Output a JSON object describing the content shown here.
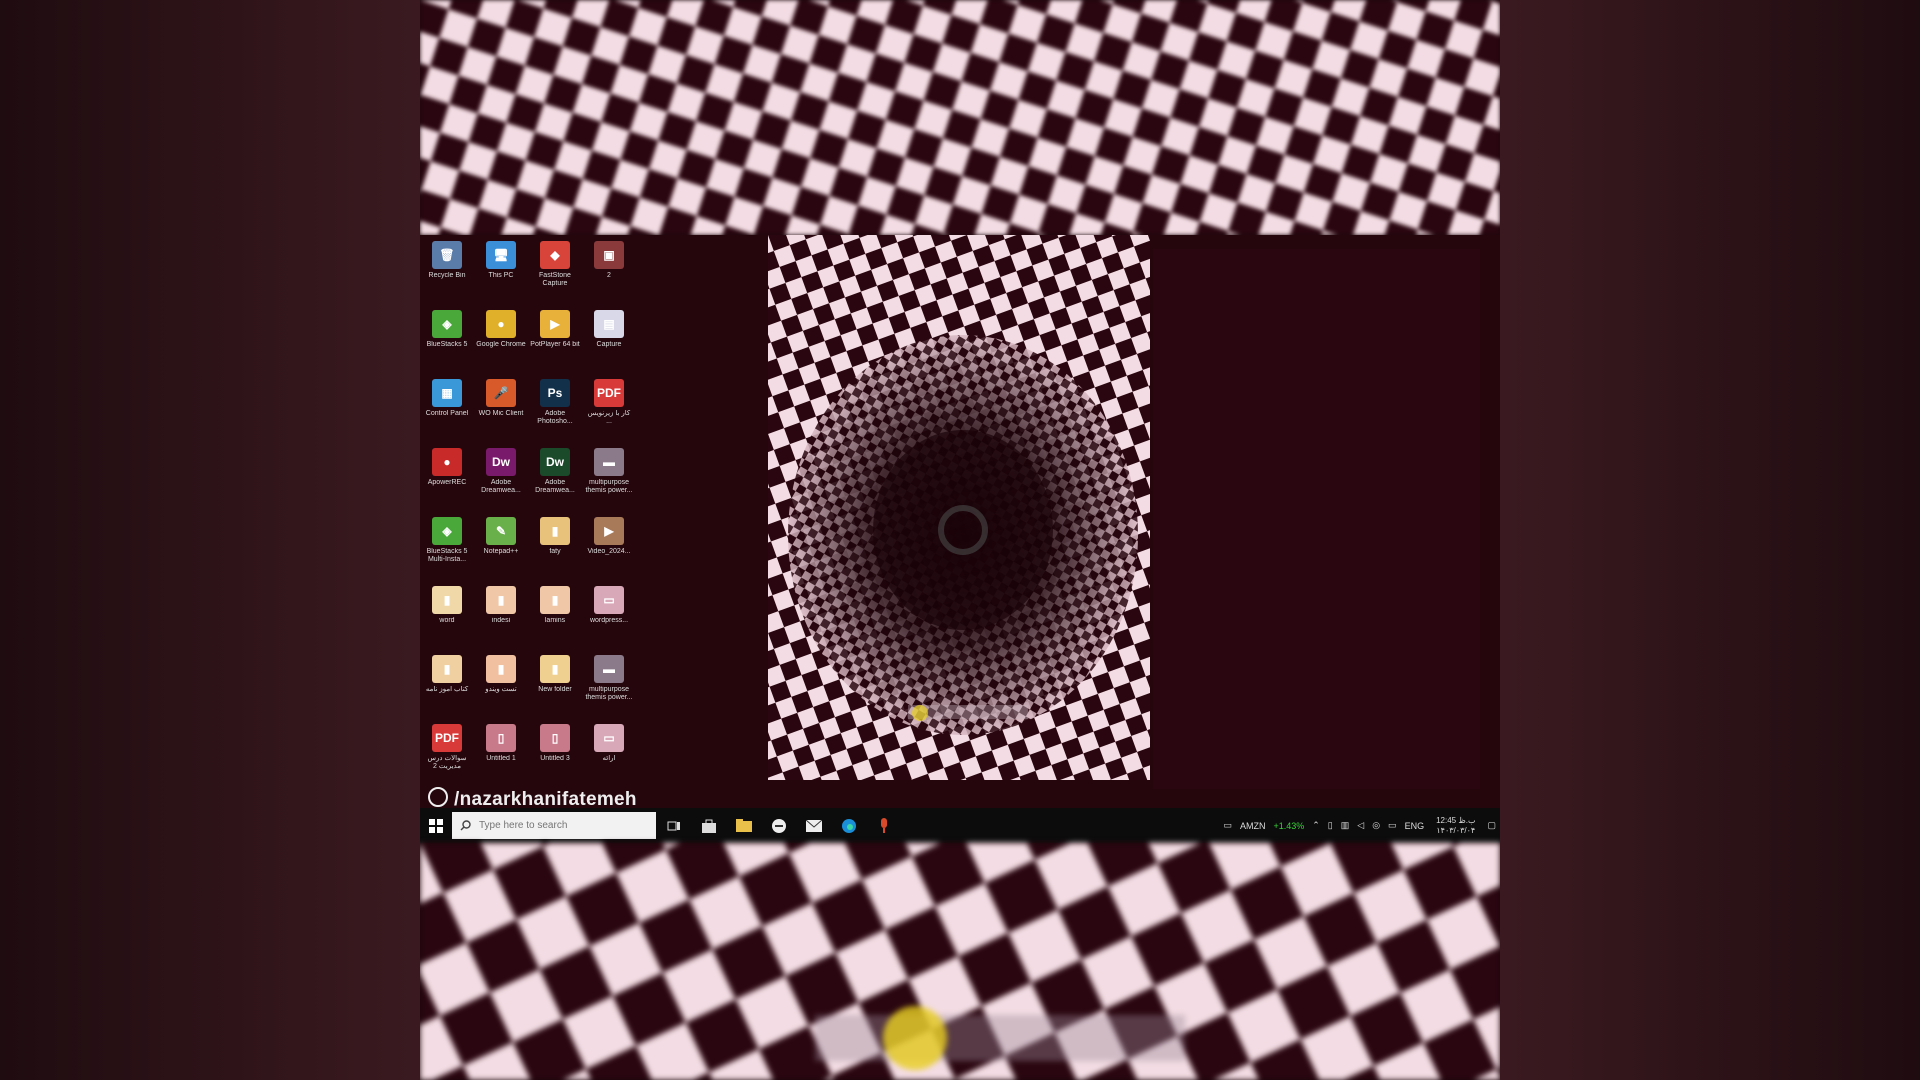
{
  "desktop": {
    "icons": [
      {
        "label": "Recycle Bin",
        "glyph": "🗑",
        "color": "#5a7ca8"
      },
      {
        "label": "This PC",
        "glyph": "🖥",
        "color": "#3a8fd8"
      },
      {
        "label": "FastStone Capture",
        "glyph": "◆",
        "color": "#d8443a"
      },
      {
        "label": "2",
        "glyph": "▣",
        "color": "#8a3a3a"
      },
      {
        "label": "BlueStacks 5",
        "glyph": "◈",
        "color": "#4aa83a"
      },
      {
        "label": "Google Chrome",
        "glyph": "●",
        "color": "#e0b02a"
      },
      {
        "label": "PotPlayer 64 bit",
        "glyph": "▶",
        "color": "#e8b23a"
      },
      {
        "label": "Capture",
        "glyph": "▤",
        "color": "#d8d8e8"
      },
      {
        "label": "Control Panel",
        "glyph": "▦",
        "color": "#3a98d8"
      },
      {
        "label": "WO Mic Client",
        "glyph": "🎤",
        "color": "#d85a2a"
      },
      {
        "label": "Adobe Photosho...",
        "glyph": "Ps",
        "color": "#12304a"
      },
      {
        "label": "کار با زیرنویس ...",
        "glyph": "PDF",
        "color": "#d83a3a"
      },
      {
        "label": "ApowerREC",
        "glyph": "●",
        "color": "#c82a2a"
      },
      {
        "label": "Adobe Dreamwea...",
        "glyph": "Dw",
        "color": "#7a1a6a"
      },
      {
        "label": "Adobe Dreamwea...",
        "glyph": "Dw",
        "color": "#1a4a2a"
      },
      {
        "label": "multipurpose themis power...",
        "glyph": "▬",
        "color": "#8a7a8a"
      },
      {
        "label": "BlueStacks 5 Multi-Insta...",
        "glyph": "◈",
        "color": "#4aa83a"
      },
      {
        "label": "Notepad++",
        "glyph": "✎",
        "color": "#6ab04a"
      },
      {
        "label": "faty",
        "glyph": "▮",
        "color": "#e8c27a"
      },
      {
        "label": "Video_2024...",
        "glyph": "▶",
        "color": "#a87a5a"
      },
      {
        "label": "word",
        "glyph": "▮",
        "color": "#f0d8a8"
      },
      {
        "label": "indesi",
        "glyph": "▮",
        "color": "#f0c8a8"
      },
      {
        "label": "lamins",
        "glyph": "▮",
        "color": "#f0c8a8"
      },
      {
        "label": "wordpress...",
        "glyph": "▭",
        "color": "#d8a8b8"
      },
      {
        "label": "کتاب آموز نامه",
        "glyph": "▮",
        "color": "#f0d0a0"
      },
      {
        "label": "تست ویندو",
        "glyph": "▮",
        "color": "#f0c0a0"
      },
      {
        "label": "New folder",
        "glyph": "▮",
        "color": "#f0d090"
      },
      {
        "label": "multipurpose themis power...",
        "glyph": "▬",
        "color": "#8a7a8a"
      },
      {
        "label": "سوالات درس مدیریت 2",
        "glyph": "PDF",
        "color": "#d83a3a"
      },
      {
        "label": "Untitled 1",
        "glyph": "▯",
        "color": "#c87a8a"
      },
      {
        "label": "Untitled 3",
        "glyph": "▯",
        "color": "#c87a8a"
      },
      {
        "label": "ارائه",
        "glyph": "▭",
        "color": "#d8a8b8"
      }
    ]
  },
  "watermark": "/nazarkhanifatemeh",
  "taskbar": {
    "search_placeholder": "Type here to search",
    "apps": [
      "task-view",
      "store",
      "file-explorer",
      "chat",
      "mail",
      "edge",
      "mic"
    ],
    "ticker_symbol": "AMZN",
    "ticker_change": "+1.43%",
    "language": "ENG",
    "time": "12:45 ب.ظ",
    "date": "۱۴۰۳/۰۳/۰۴"
  },
  "colors": {
    "checker_dark": "#2a0610",
    "checker_light": "#f3dce3",
    "desktop_bg": "#25060d",
    "taskbar_bg": "#0c0c0c"
  }
}
